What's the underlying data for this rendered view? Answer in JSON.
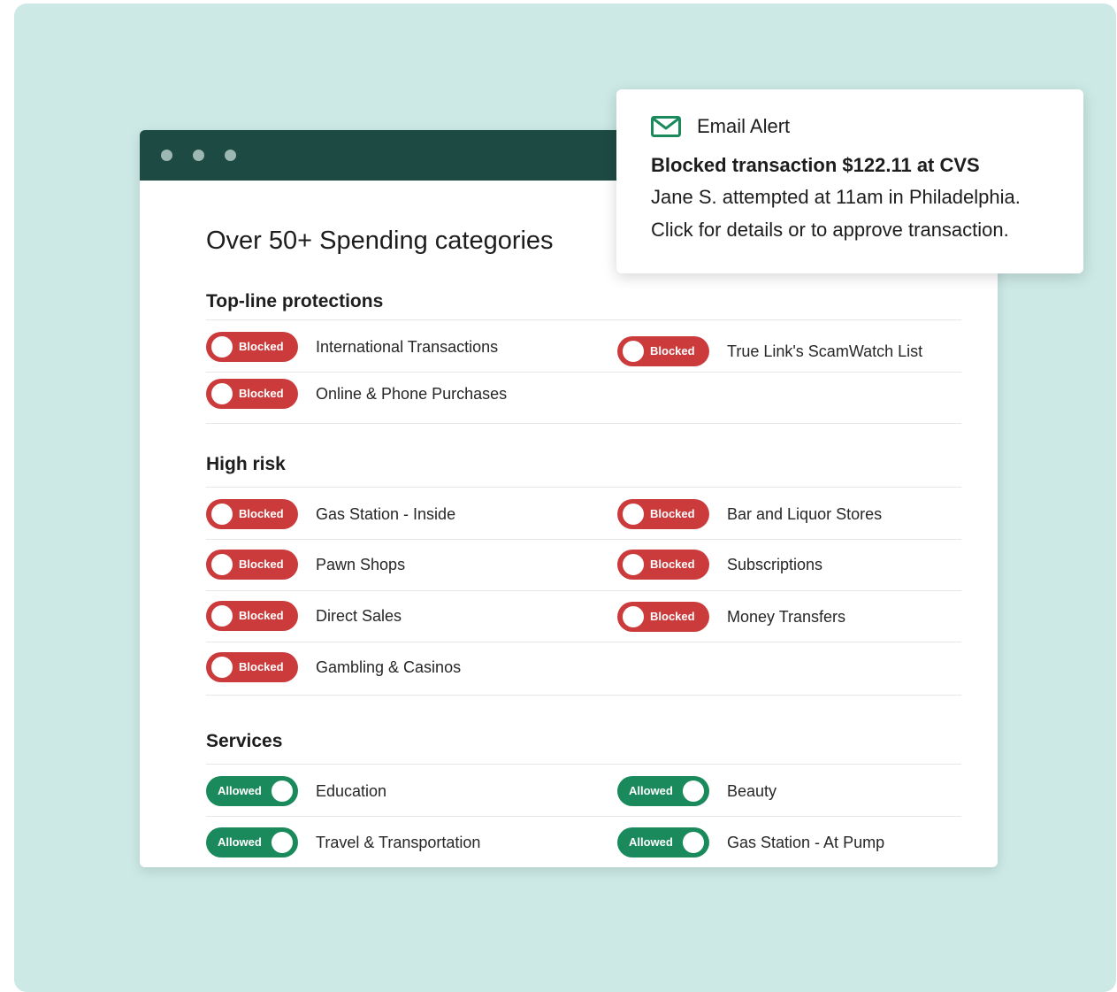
{
  "page": {
    "title": "Over 50+ Spending categories"
  },
  "sections": [
    {
      "heading": "Top-line protections",
      "items": [
        {
          "label": "International Transactions",
          "state": "Blocked"
        },
        {
          "label": "True Link's ScamWatch List",
          "state": "Blocked"
        },
        {
          "label": "Online & Phone Purchases",
          "state": "Blocked"
        }
      ]
    },
    {
      "heading": "High risk",
      "items": [
        {
          "label": "Gas Station - Inside",
          "state": "Blocked"
        },
        {
          "label": "Bar and Liquor Stores",
          "state": "Blocked"
        },
        {
          "label": "Pawn Shops",
          "state": "Blocked"
        },
        {
          "label": "Subscriptions",
          "state": "Blocked"
        },
        {
          "label": "Direct Sales",
          "state": "Blocked"
        },
        {
          "label": "Money Transfers",
          "state": "Blocked"
        },
        {
          "label": "Gambling & Casinos",
          "state": "Blocked"
        }
      ]
    },
    {
      "heading": "Services",
      "items": [
        {
          "label": "Education",
          "state": "Allowed"
        },
        {
          "label": "Beauty",
          "state": "Allowed"
        },
        {
          "label": "Travel & Transportation",
          "state": "Allowed"
        },
        {
          "label": "Gas Station - At Pump",
          "state": "Allowed"
        }
      ]
    }
  ],
  "alert": {
    "icon": "mail-icon",
    "title": "Email Alert",
    "headline": "Blocked transaction $122.11 at CVS",
    "line1": "Jane S. attempted at 11am in Philadelphia.",
    "line2": "Click for details or to approve transaction."
  },
  "colors": {
    "backdrop": "#cce9e5",
    "titlebar": "#1e4a44",
    "blocked": "#cc3b3b",
    "allowed": "#1a8a5c",
    "mail_icon": "#1a8a5c"
  }
}
